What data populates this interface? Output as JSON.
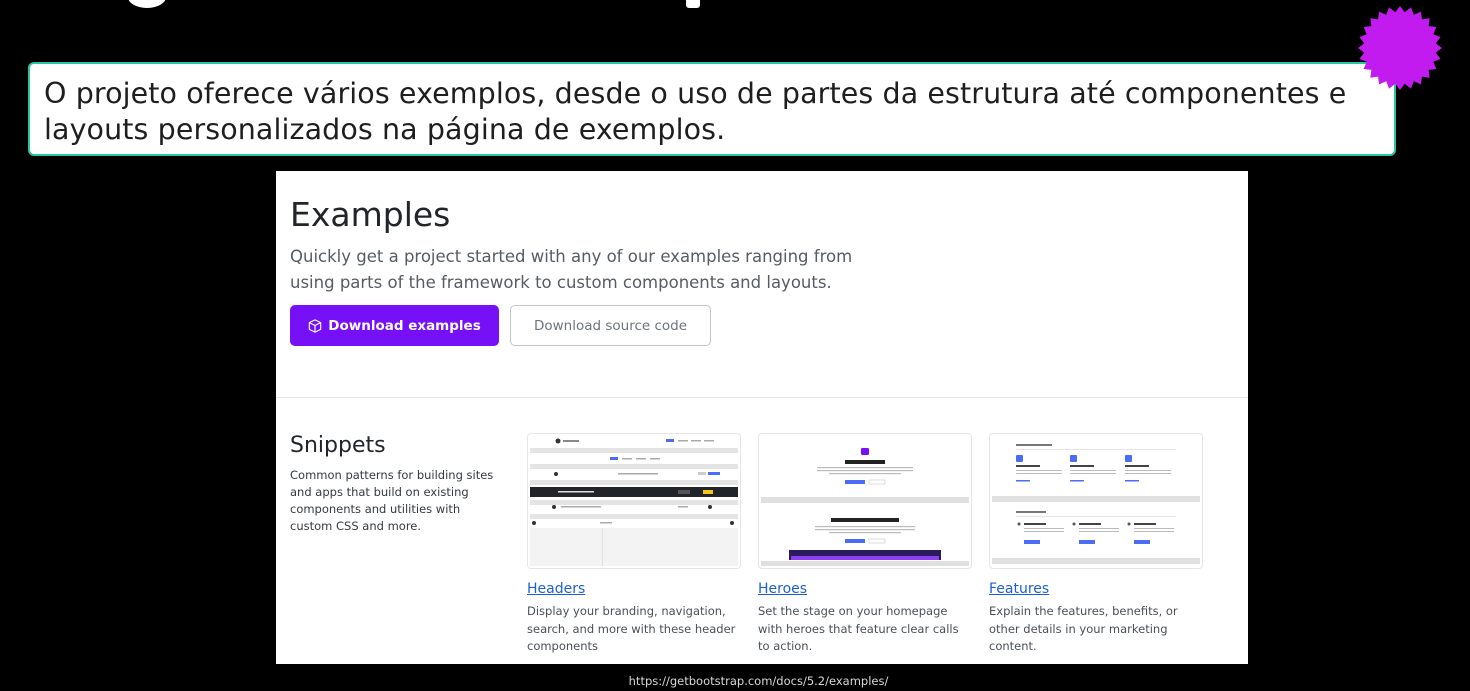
{
  "caption": {
    "text": "O projeto oferece vários exemplos, desde o uso de partes da estrutura até componentes e layouts personalizados na página de exemplos."
  },
  "decor": {
    "burst_color": "#c21bf0",
    "caption_border": "#29c4a0"
  },
  "page": {
    "title": "Examples",
    "lead": "Quickly get a project started with any of our examples ranging from using parts of the framework to custom components and layouts.",
    "buttons": {
      "download_examples": "Download examples",
      "download_source": "Download source code"
    },
    "accent": "#7510f7",
    "snippets": {
      "title": "Snippets",
      "description": "Common patterns for building sites and apps that build on existing components and utilities with custom CSS and more.",
      "cards": [
        {
          "name": "Headers",
          "description": "Display your branding, navigation, search, and more with these header components"
        },
        {
          "name": "Heroes",
          "description": "Set the stage on your homepage with heroes that feature clear calls to action."
        },
        {
          "name": "Features",
          "description": "Explain the features, benefits, or other details in your marketing content."
        }
      ]
    }
  },
  "source_url": "https://getbootstrap.com/docs/5.2/examples/"
}
